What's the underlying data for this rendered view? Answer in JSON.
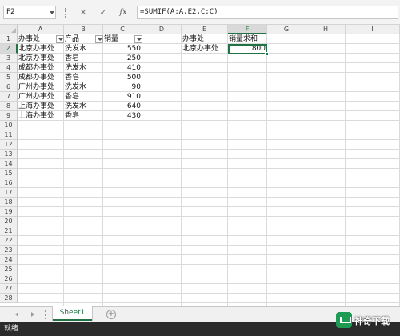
{
  "formula_bar": {
    "name_box": "F2",
    "cancel_icon": "close-icon",
    "enter_icon": "check-icon",
    "fx_label": "fx",
    "formula": "=SUMIF(A:A,E2,C:C)"
  },
  "grid": {
    "columns": [
      "A",
      "B",
      "C",
      "D",
      "E",
      "F",
      "G",
      "H",
      "I"
    ],
    "rows": [
      "1",
      "2",
      "3",
      "4",
      "5",
      "6",
      "7",
      "8",
      "9",
      "10",
      "11",
      "12",
      "13",
      "14",
      "15",
      "16",
      "17",
      "18",
      "19",
      "20",
      "21",
      "22",
      "23",
      "24",
      "25",
      "26",
      "27",
      "28"
    ],
    "active_cell": "F2",
    "cells": {
      "A1": "办事处",
      "B1": "产品",
      "C1": "销量",
      "A2": "北京办事处",
      "B2": "洗发水",
      "C2": "550",
      "A3": "北京办事处",
      "B3": "香皂",
      "C3": "250",
      "A4": "成都办事处",
      "B4": "洗发水",
      "C4": "410",
      "A5": "成都办事处",
      "B5": "香皂",
      "C5": "500",
      "A6": "广州办事处",
      "B6": "洗发水",
      "C6": "90",
      "A7": "广州办事处",
      "B7": "香皂",
      "C7": "910",
      "A8": "上海办事处",
      "B8": "洗发水",
      "C8": "640",
      "A9": "上海办事处",
      "B9": "香皂",
      "C9": "430",
      "E1": "办事处",
      "F1": "销量求和",
      "E2": "北京办事处",
      "F2": "800"
    }
  },
  "sheet_tabs": {
    "tabs": [
      "Sheet1"
    ],
    "active": "Sheet1",
    "add_label": "+"
  },
  "status_bar": {
    "status": "就绪"
  },
  "watermark": {
    "text": "神奇下载"
  },
  "colors": {
    "accent": "#217346",
    "status_bar_bg": "#2b2b2b"
  }
}
